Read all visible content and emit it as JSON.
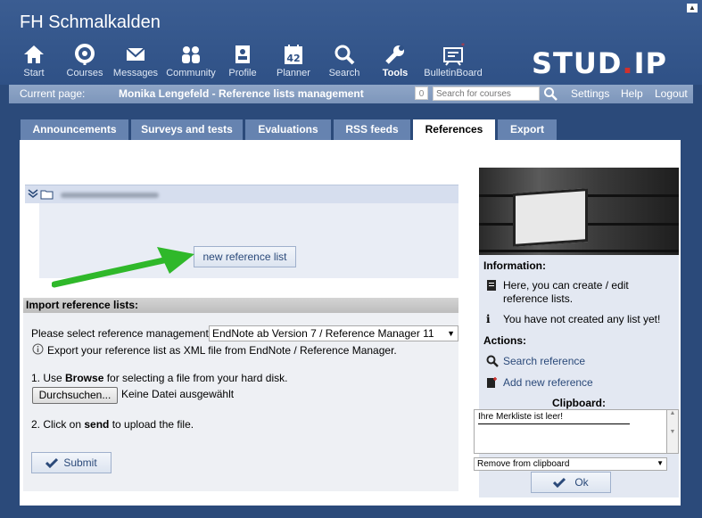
{
  "header": {
    "brand": "FH Schmalkalden",
    "logo_main": "STUD",
    "logo_dot": ".",
    "logo_end": "IP",
    "nav": [
      {
        "label": "Start",
        "icon": "home-icon"
      },
      {
        "label": "Courses",
        "icon": "courses-icon"
      },
      {
        "label": "Messages",
        "icon": "mail-icon"
      },
      {
        "label": "Community",
        "icon": "community-icon"
      },
      {
        "label": "Profile",
        "icon": "profile-icon"
      },
      {
        "label": "Planner",
        "icon": "calendar-icon",
        "badge": "42"
      },
      {
        "label": "Search",
        "icon": "search-icon"
      },
      {
        "label": "Tools",
        "icon": "wrench-icon",
        "active": true
      },
      {
        "label": "BulletinBoard",
        "icon": "bulletin-icon"
      }
    ]
  },
  "statusbar": {
    "current_page_label": "Current page:",
    "current_page_value": "Monika Lengefeld - Reference lists management",
    "count": "0",
    "search_placeholder": "Search for courses",
    "settings": "Settings",
    "help": "Help",
    "logout": "Logout"
  },
  "tabs": [
    "Announcements",
    "Surveys and tests",
    "Evaluations",
    "RSS feeds",
    "References",
    "Export"
  ],
  "active_tab": "References",
  "main": {
    "new_list_button": "new reference list",
    "import_header": "Import reference lists:",
    "select_label": "Please select reference management:",
    "select_value": "EndNote ab Version 7 / Reference Manager 11",
    "export_hint": "Export your reference list as XML file from EndNote / Reference Manager.",
    "step1_pre": "1. Use ",
    "step1_bold": "Browse",
    "step1_post": " for selecting a file from your hard disk.",
    "browse_button": "Durchsuchen...",
    "no_file": "Keine Datei ausgewählt",
    "step2_pre": "2. Click on ",
    "step2_bold": "send",
    "step2_post": " to upload the file.",
    "submit_button": "Submit"
  },
  "sidebar": {
    "info_title": "Information:",
    "info1": "Here, you can create / edit reference lists.",
    "info2": "You have not created any list yet!",
    "actions_title": "Actions:",
    "action1": "Search reference",
    "action2": "Add new reference",
    "clipboard_title": "Clipboard:",
    "clipboard_text": "Ihre Merkliste ist leer!",
    "clipboard_select": "Remove from clipboard",
    "ok_button": "Ok"
  },
  "colors": {
    "header_bg": "#2f5186",
    "accent": "#2b4a7a",
    "arrow": "#2fb82a"
  }
}
